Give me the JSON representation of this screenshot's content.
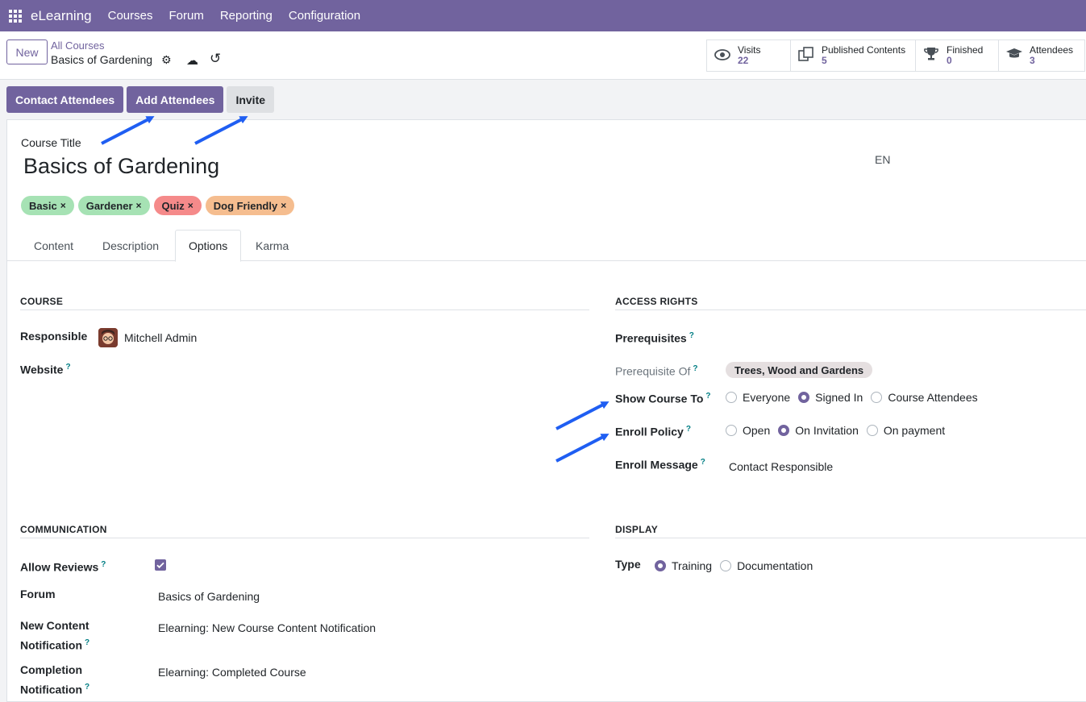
{
  "navbar": {
    "brand": "eLearning",
    "items": [
      "Courses",
      "Forum",
      "Reporting",
      "Configuration"
    ]
  },
  "control": {
    "new_label": "New",
    "breadcrumb_parent": "All Courses",
    "breadcrumb_current": "Basics of Gardening",
    "stats": [
      {
        "label": "Visits",
        "value": "22",
        "icon": "eye-icon"
      },
      {
        "label": "Published Contents",
        "value": "5",
        "icon": "copy-icon"
      },
      {
        "label": "Finished",
        "value": "0",
        "icon": "trophy-icon"
      },
      {
        "label": "Attendees",
        "value": "3",
        "icon": "graduation-cap-icon"
      }
    ]
  },
  "actions": {
    "contact": "Contact Attendees",
    "add": "Add Attendees",
    "invite": "Invite"
  },
  "form": {
    "course_title_label": "Course Title",
    "course_title": "Basics of Gardening",
    "lang": "EN",
    "tags": [
      {
        "label": "Basic",
        "color": "#a6e2b4"
      },
      {
        "label": "Gardener",
        "color": "#a6e2b4"
      },
      {
        "label": "Quiz",
        "color": "#f58a8a"
      },
      {
        "label": "Dog Friendly",
        "color": "#f5bd8f"
      }
    ],
    "tabs": [
      "Content",
      "Description",
      "Options",
      "Karma"
    ],
    "active_tab": "Options"
  },
  "course": {
    "section": "COURSE",
    "responsible_label": "Responsible",
    "responsible": "Mitchell Admin",
    "website_label": "Website"
  },
  "access": {
    "section": "ACCESS RIGHTS",
    "prerequisites_label": "Prerequisites",
    "prerequisite_of_label": "Prerequisite Of",
    "prerequisite_of": "Trees, Wood and Gardens",
    "show_course_label": "Show Course To",
    "show_course_options": [
      "Everyone",
      "Signed In",
      "Course Attendees"
    ],
    "show_course_selected": 1,
    "enroll_policy_label": "Enroll Policy",
    "enroll_policy_options": [
      "Open",
      "On Invitation",
      "On payment"
    ],
    "enroll_policy_selected": 1,
    "enroll_message_label": "Enroll Message",
    "enroll_message": "Contact Responsible"
  },
  "communication": {
    "section": "COMMUNICATION",
    "allow_reviews_label": "Allow Reviews",
    "allow_reviews": true,
    "forum_label": "Forum",
    "forum": "Basics of Gardening",
    "new_content_label_1": "New Content",
    "new_content_label_2": "Notification",
    "new_content": "Elearning: New Course Content Notification",
    "completion_label_1": "Completion",
    "completion_label_2": "Notification",
    "completion": "Elearning: Completed Course"
  },
  "display": {
    "section": "DISPLAY",
    "type_label": "Type",
    "type_options": [
      "Training",
      "Documentation"
    ],
    "type_selected": 0
  },
  "help_mark": "?",
  "tag_remove": "×",
  "colors": {
    "brand": "#71639e",
    "arrow": "#1f5ef2"
  }
}
